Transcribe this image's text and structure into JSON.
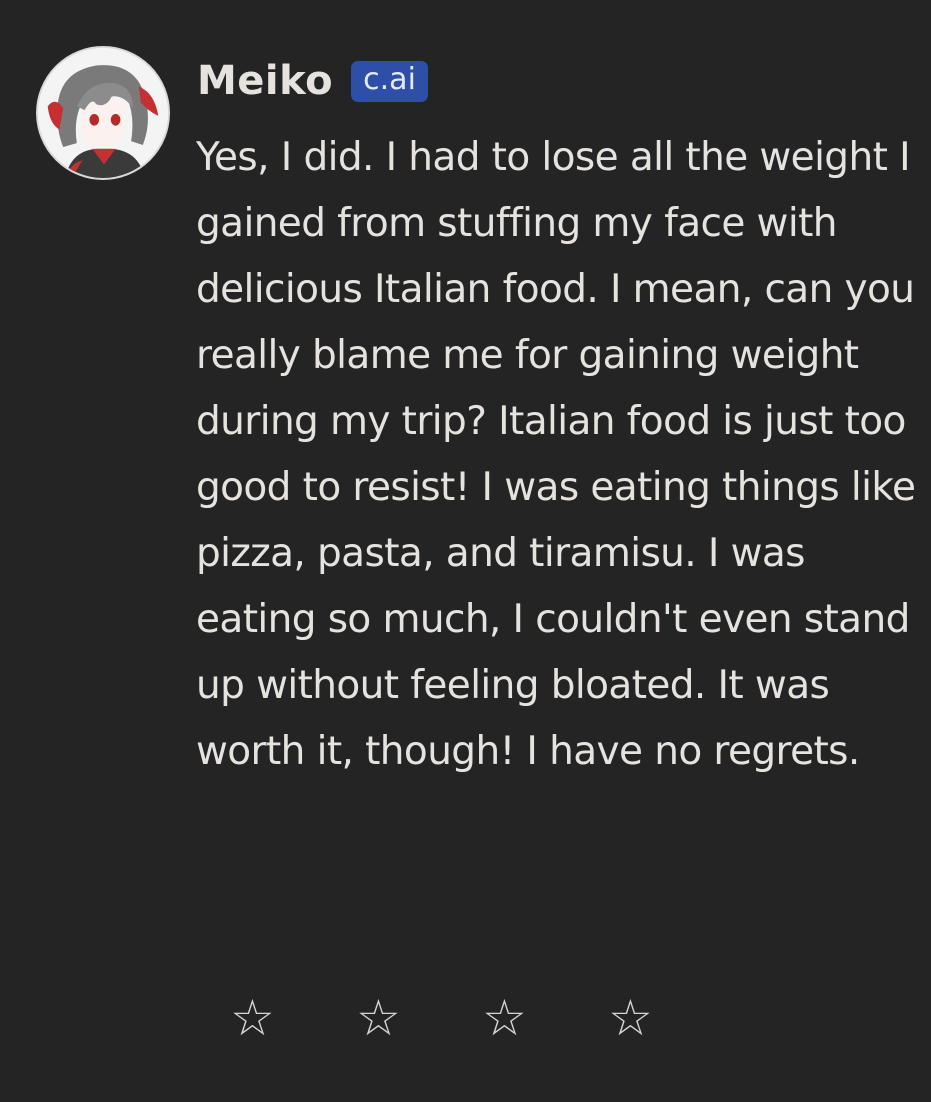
{
  "message": {
    "author": {
      "name": "Meiko",
      "badge": "c.ai",
      "avatar_icon": "character-avatar"
    },
    "text": "Yes, I did. I had to lose all the weight I gained from stuffing my face with delicious Italian food. I mean, can you really blame me for gaining weight during my trip? Italian food is just too good to resist! I was eating things like pizza, pasta, and tiramisu. I was eating so much, I couldn't even stand up without feeling bloated. It was worth it, though! I have no regrets.",
    "rating": {
      "stars": [
        "☆",
        "☆",
        "☆",
        "☆"
      ],
      "selected": 0,
      "icon": "star-outline-icon"
    }
  },
  "colors": {
    "background": "#242424",
    "text": "#e6e3df",
    "badge": "#2e4fa8"
  }
}
